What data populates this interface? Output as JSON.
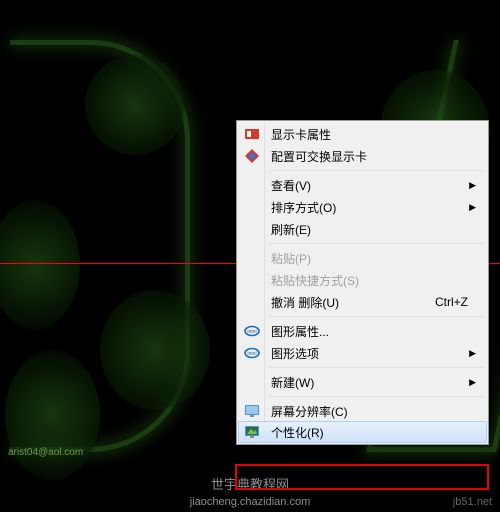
{
  "wallpaper": {
    "credit_text": "arist04@aol.com"
  },
  "context_menu": {
    "display_card_props": "显示卡属性",
    "config_switchable_gpu": "配置可交换显示卡",
    "view": "查看(V)",
    "sort_by": "排序方式(O)",
    "refresh": "刷新(E)",
    "paste": "粘贴(P)",
    "paste_shortcut": "粘贴快捷方式(S)",
    "undo_delete": "撤消 删除(U)",
    "undo_shortcut": "Ctrl+Z",
    "graphics_props": "图形属性...",
    "graphics_options": "图形选项",
    "new": "新建(W)",
    "screen_resolution": "屏幕分辨率(C)",
    "personalize": "个性化(R)"
  },
  "watermark": {
    "main": "世宇典教程网",
    "sub": "jiaocheng.chazidian.com",
    "right": "jb51.net"
  }
}
